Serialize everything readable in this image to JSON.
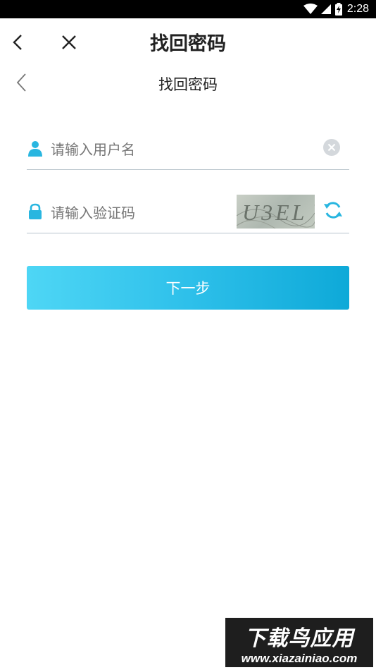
{
  "status_bar": {
    "time": "2:28",
    "icons": [
      "wifi-icon",
      "signal-icon",
      "battery-icon"
    ]
  },
  "app_bar": {
    "title": "找回密码",
    "back_icon": "chevron-left-icon",
    "close_icon": "close-icon"
  },
  "sub_header": {
    "title": "找回密码",
    "back_icon": "chevron-left-icon"
  },
  "form": {
    "username": {
      "placeholder": "请输入用户名",
      "value": "",
      "icon": "user-icon",
      "clear_icon": "clear-icon"
    },
    "captcha": {
      "placeholder": "请输入验证码",
      "value": "",
      "icon": "lock-icon",
      "image_text": "U3EL",
      "refresh_icon": "refresh-icon"
    },
    "next_button": "下一步"
  },
  "watermark": {
    "line1": "下载鸟应用",
    "line2": "www.xiazainiao.com"
  },
  "colors": {
    "accent": "#29b6e0",
    "button_gradient_start": "#4ed6f5",
    "button_gradient_end": "#0ea9d8",
    "divider": "#b8c4cc",
    "placeholder": "#777777"
  }
}
